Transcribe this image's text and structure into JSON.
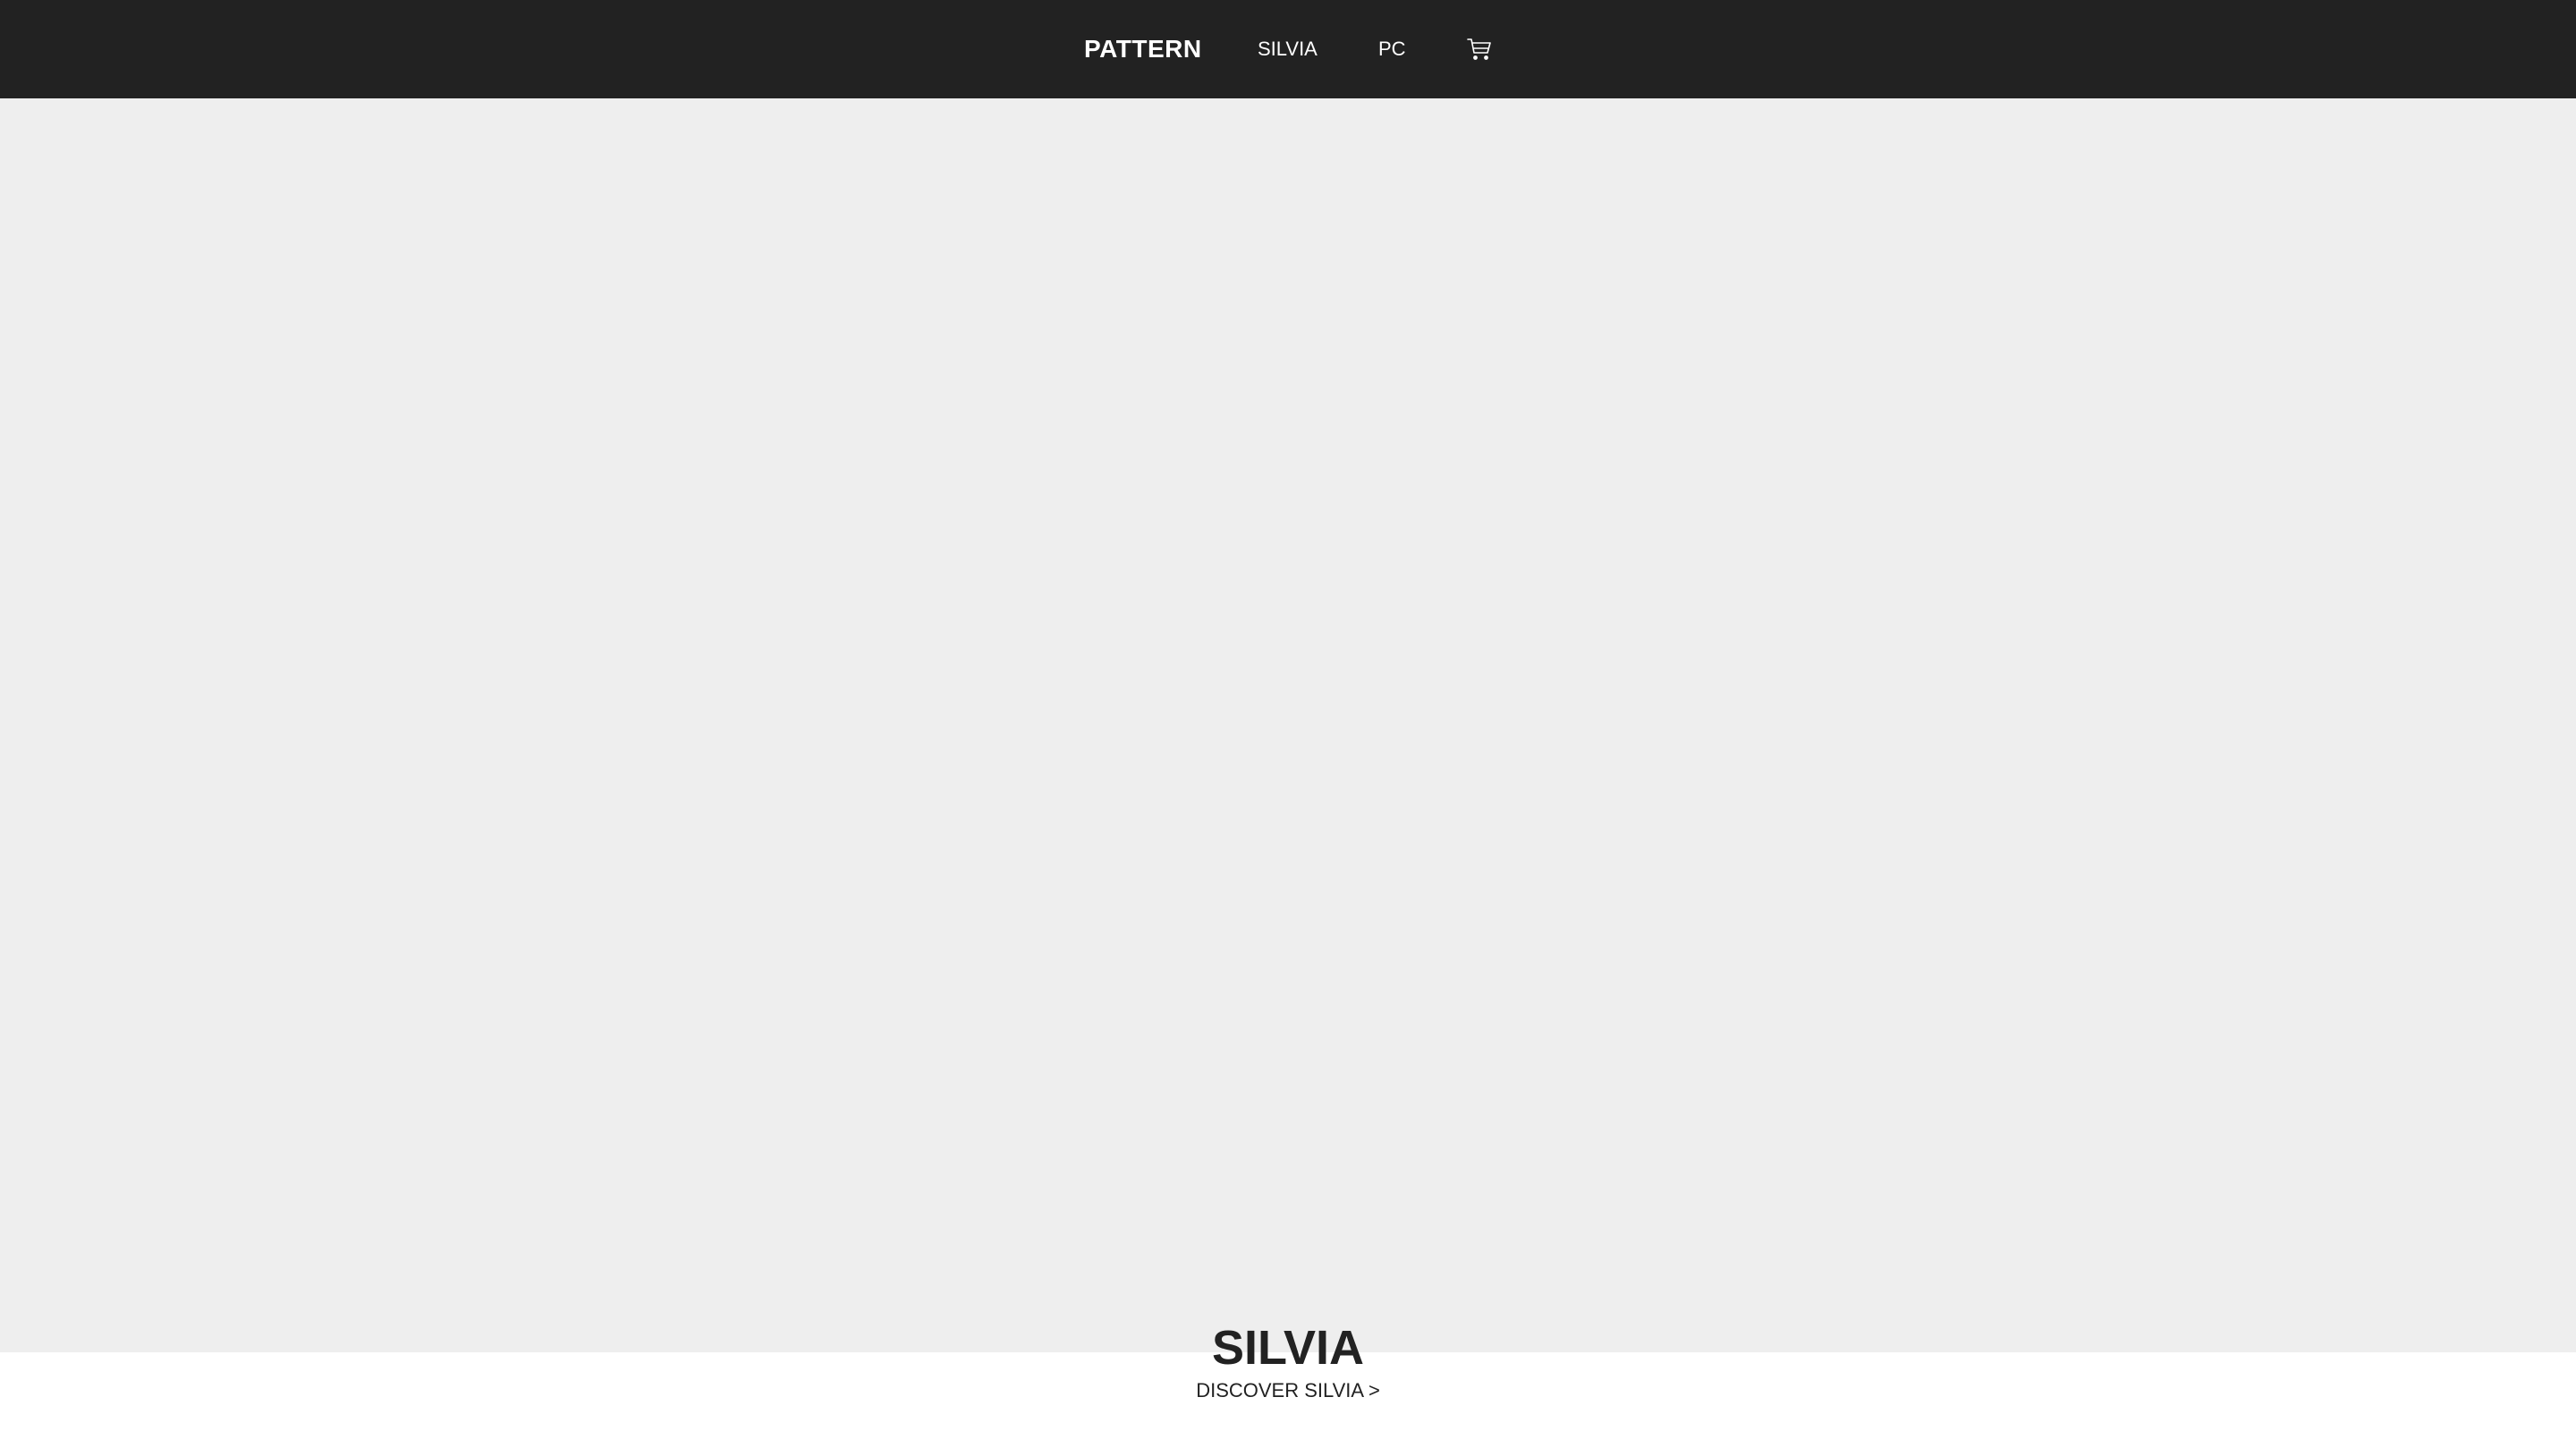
{
  "header": {
    "brand": "PATTERN",
    "nav": [
      {
        "label": "SILVIA"
      },
      {
        "label": "PC"
      }
    ],
    "cart_icon": "shopping-cart-icon"
  },
  "hero": {
    "title": "SILVIA",
    "cta": "DISCOVER SILVIA >"
  },
  "colors": {
    "header_bg": "#222222",
    "hero_bg": "#eeeeee",
    "page_bg": "#ffffff",
    "text_dark": "#222222",
    "text_light": "#ffffff"
  }
}
